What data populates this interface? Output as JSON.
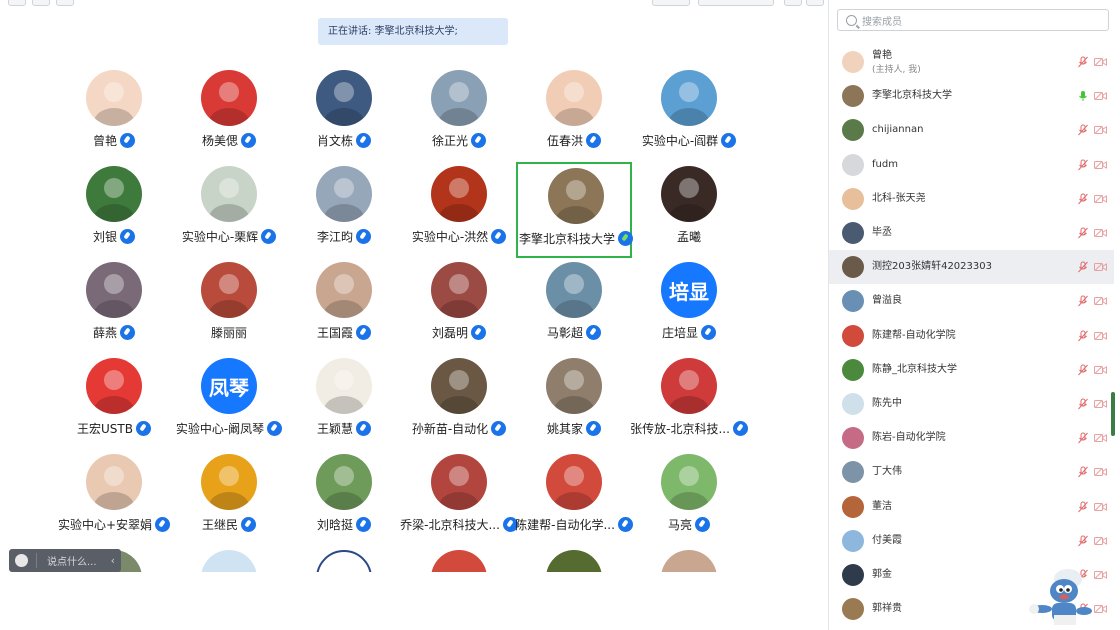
{
  "speaker_banner": "正在讲话: 李擎北京科技大学;",
  "chat_placeholder": "说点什么...",
  "search_placeholder": "搜索成员",
  "tiles": [
    {
      "name": "曾艳",
      "color": "#f4d7c4",
      "active": false
    },
    {
      "name": "杨美偲",
      "color": "#d93a35",
      "active": false
    },
    {
      "name": "肖文栋",
      "color": "#3e5a80",
      "active": false
    },
    {
      "name": "徐正光",
      "color": "#8aa0b4",
      "active": false
    },
    {
      "name": "伍春洪",
      "color": "#f2cdb6",
      "active": false
    },
    {
      "name": "实验中心-阎群",
      "color": "#5c9fd2",
      "active": false
    },
    {
      "name": "刘银",
      "color": "#3f7a3d",
      "active": false
    },
    {
      "name": "实验中心-栗辉",
      "color": "#c8d4c8",
      "active": false
    },
    {
      "name": "李江昀",
      "color": "#96a7b9",
      "active": false
    },
    {
      "name": "实验中心-洪然",
      "color": "#b2341a",
      "active": false
    },
    {
      "name": "李擎北京科技大学",
      "color": "#8c7657",
      "active": true
    },
    {
      "name": "孟曦",
      "color": "#3a2a26",
      "active": false
    },
    {
      "name": "薛燕",
      "color": "#7a6a78",
      "active": false
    },
    {
      "name": "滕丽丽",
      "color": "#b84b3b",
      "active": false
    },
    {
      "name": "王国霞",
      "color": "#c9a690",
      "active": false
    },
    {
      "name": "刘磊明",
      "color": "#9b4a44",
      "active": false
    },
    {
      "name": "马彰超",
      "color": "#6c8fa8",
      "active": false
    },
    {
      "name": "庄培显",
      "color": "#1677ff",
      "active": false,
      "text": "培显"
    },
    {
      "name": "王宏USTB",
      "color": "#e53935",
      "active": false
    },
    {
      "name": "实验中心-阚凤琴",
      "color": "#1677ff",
      "active": false,
      "text": "凤琴"
    },
    {
      "name": "王颖慧",
      "color": "#f1ede4",
      "active": false
    },
    {
      "name": "孙新苗-自动化",
      "color": "#6a5844",
      "active": false
    },
    {
      "name": "姚其家",
      "color": "#8f7e6c",
      "active": false
    },
    {
      "name": "张传放-北京科技...",
      "color": "#cf3a3a",
      "active": false
    },
    {
      "name": "实验中心+安翠娟",
      "color": "#e9c9b2",
      "active": false
    },
    {
      "name": "王继民",
      "color": "#e8a21a",
      "active": false
    },
    {
      "name": "刘晗挺",
      "color": "#6e9a5a",
      "active": false
    },
    {
      "name": "乔梁-北京科技大...",
      "color": "#b2463f",
      "active": false
    },
    {
      "name": "陈建帮-自动化学...",
      "color": "#d24a3c",
      "active": false
    },
    {
      "name": "马亮",
      "color": "#7eb86a",
      "active": false
    }
  ],
  "members": [
    {
      "name": "曾艳",
      "sub": "(主持人, 我)",
      "color": "#f0d2bd",
      "mic": "muted",
      "hl": false
    },
    {
      "name": "李擎北京科技大学",
      "sub": "",
      "color": "#8c7657",
      "mic": "on",
      "hl": false
    },
    {
      "name": "chijiannan",
      "sub": "",
      "color": "#5b7a4a",
      "mic": "muted",
      "hl": false
    },
    {
      "name": "fudm",
      "sub": "",
      "color": "#d6d8dc",
      "mic": "muted",
      "hl": false
    },
    {
      "name": "北科-张天尧",
      "sub": "",
      "color": "#e7c09b",
      "mic": "muted",
      "hl": false
    },
    {
      "name": "毕丞",
      "sub": "",
      "color": "#4a5a70",
      "mic": "muted",
      "hl": false
    },
    {
      "name": "测控203张婧轩42023303",
      "sub": "",
      "color": "#6a5a4a",
      "mic": "muted",
      "hl": true
    },
    {
      "name": "曾溢良",
      "sub": "",
      "color": "#6a8fb4",
      "mic": "muted",
      "hl": false
    },
    {
      "name": "陈建帮-自动化学院",
      "sub": "",
      "color": "#d24a3c",
      "mic": "muted",
      "hl": false
    },
    {
      "name": "陈静_北京科技大学",
      "sub": "",
      "color": "#4b8a3c",
      "mic": "muted",
      "hl": false
    },
    {
      "name": "陈先中",
      "sub": "",
      "color": "#cfe0ea",
      "mic": "muted",
      "hl": false
    },
    {
      "name": "陈岩-自动化学院",
      "sub": "",
      "color": "#c66b86",
      "mic": "muted",
      "hl": false
    },
    {
      "name": "丁大伟",
      "sub": "",
      "color": "#7d93a8",
      "mic": "muted",
      "hl": false
    },
    {
      "name": "董洁",
      "sub": "",
      "color": "#b5653a",
      "mic": "muted",
      "hl": false
    },
    {
      "name": "付美霞",
      "sub": "",
      "color": "#8db7dd",
      "mic": "muted",
      "hl": false
    },
    {
      "name": "郭金",
      "sub": "",
      "color": "#2f3a4a",
      "mic": "muted",
      "hl": false
    },
    {
      "name": "郭祥贵",
      "sub": "",
      "color": "#9a7a52",
      "mic": "muted",
      "hl": false
    }
  ]
}
